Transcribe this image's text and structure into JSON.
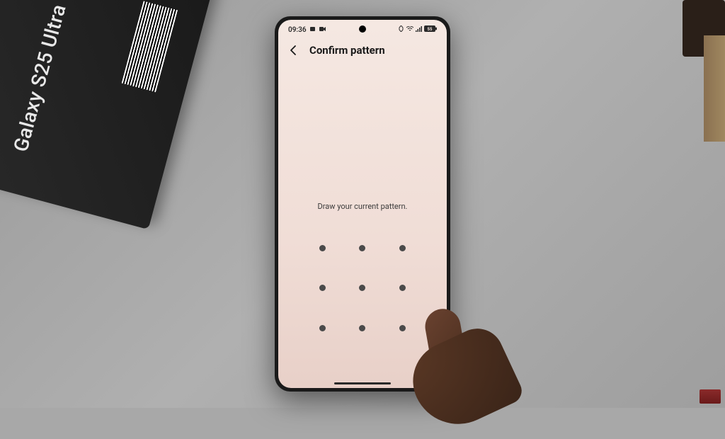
{
  "box": {
    "label": "Galaxy S25 Ultra"
  },
  "statusBar": {
    "time": "09:36",
    "battery": "55"
  },
  "header": {
    "title": "Confirm pattern"
  },
  "instruction": "Draw your current pattern.",
  "patternDots": 9
}
